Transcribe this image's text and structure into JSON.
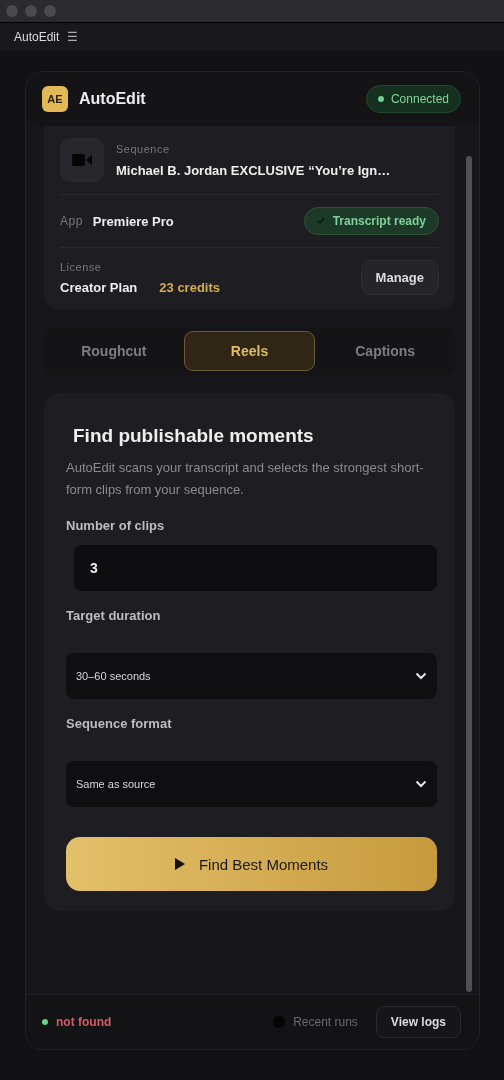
{
  "app_bar": {
    "title": "AutoEdit",
    "menu_glyph": "☰"
  },
  "header": {
    "logo": "AE",
    "title": "AutoEdit",
    "status": "Connected"
  },
  "sequence": {
    "label": "Sequence",
    "value": "Michael B. Jordan EXCLUSIVE “You’re Ign…"
  },
  "app": {
    "label": "App",
    "value": "Premiere Pro",
    "badge": "Transcript ready"
  },
  "license": {
    "label": "License",
    "plan": "Creator Plan",
    "credits": "23 credits",
    "button": "Manage"
  },
  "tabs": [
    {
      "label": "Roughcut",
      "selected": false
    },
    {
      "label": "Reels",
      "selected": true
    },
    {
      "label": "Captions",
      "selected": false
    }
  ],
  "reels": {
    "title": "Find publishable moments",
    "description": "AutoEdit scans your transcript and selects the strongest short-form clips from your sequence.",
    "fields": [
      {
        "kind": "input",
        "label": "Number of clips",
        "value": "3"
      },
      {
        "kind": "select",
        "label": "Target duration",
        "value": "30–60 seconds"
      },
      {
        "kind": "select",
        "label": "Sequence format",
        "value": "Same as source"
      }
    ],
    "action": "Find Best Moments"
  },
  "footer": {
    "status": "not found",
    "recent": "Recent runs",
    "button": "View logs"
  }
}
